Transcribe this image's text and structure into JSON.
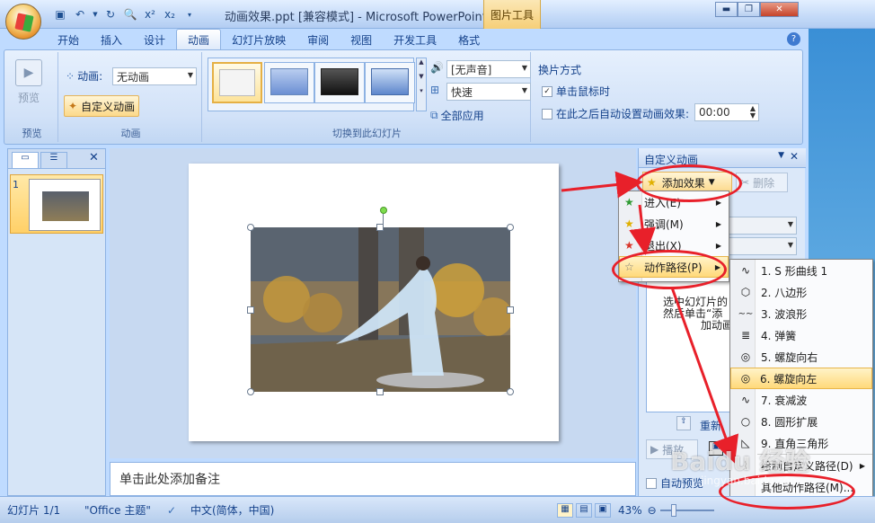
{
  "window": {
    "title": "动画效果.ppt [兼容模式] - Microsoft PowerPoint",
    "tool_context": "图片工具"
  },
  "tabs": [
    {
      "label": "开始",
      "active": false
    },
    {
      "label": "插入",
      "active": false
    },
    {
      "label": "设计",
      "active": false
    },
    {
      "label": "动画",
      "active": true
    },
    {
      "label": "幻灯片放映",
      "active": false
    },
    {
      "label": "审阅",
      "active": false
    },
    {
      "label": "视图",
      "active": false
    },
    {
      "label": "开发工具",
      "active": false
    },
    {
      "label": "格式",
      "active": false
    }
  ],
  "ribbon": {
    "preview_group": {
      "button": "预览",
      "label": "预览"
    },
    "animation_group": {
      "anim_label": "动画:",
      "anim_value": "无动画",
      "custom_anim": "自定义动画",
      "label": "动画"
    },
    "transition_group": {
      "sound_value": "[无声音]",
      "speed_value": "快速",
      "apply_all": "全部应用",
      "label": "切换到此幻灯片"
    },
    "advance_group": {
      "title": "换片方式",
      "on_click": "单击鼠标时",
      "on_click_checked": true,
      "auto_after": "在此之后自动设置动画效果:",
      "auto_after_checked": false,
      "auto_time": "00:00"
    }
  },
  "left_pane": {
    "slide_number": "1"
  },
  "notes": {
    "placeholder": "单击此处添加备注"
  },
  "custom_pane": {
    "title": "自定义动画",
    "add_effect": "添加效果",
    "remove": "删除",
    "hint_line1": "选中幻灯片的",
    "hint_line2": "然后单击“添",
    "hint_line3": "加动画",
    "reorder": "重新",
    "play": "播放",
    "auto_preview": "自动预览"
  },
  "menu_effect_types": [
    {
      "label": "进入(E)"
    },
    {
      "label": "强调(M)"
    },
    {
      "label": "退出(X)"
    },
    {
      "label": "动作路径(P)",
      "highlighted": true
    }
  ],
  "menu_paths": [
    {
      "label": "1. S 形曲线 1",
      "icon": "s-curve-icon"
    },
    {
      "label": "2. 八边形",
      "icon": "octagon-icon"
    },
    {
      "label": "3. 波浪形",
      "icon": "wave-icon"
    },
    {
      "label": "4. 弹簧",
      "icon": "spring-icon"
    },
    {
      "label": "5. 螺旋向右",
      "icon": "spiral-right-icon"
    },
    {
      "label": "6. 螺旋向左",
      "icon": "spiral-left-icon",
      "highlighted": true
    },
    {
      "label": "7. 衰减波",
      "icon": "decaying-wave-icon"
    },
    {
      "label": "8. 圆形扩展",
      "icon": "circle-expand-icon"
    },
    {
      "label": "9. 直角三角形",
      "icon": "right-triangle-icon"
    },
    {
      "label": "绘制自定义路径(D)",
      "icon": "draw-path-icon",
      "submenu": true
    },
    {
      "label": "其他动作路径(M)...",
      "icon": "",
      "submenu": false
    }
  ],
  "status": {
    "slide": "幻灯片 1/1",
    "theme": "\"Office 主题\"",
    "language": "中文(简体，中国)",
    "zoom": "43%"
  },
  "watermark": {
    "line1": "Baidu 经验",
    "line2": "jingyan.baidu.com"
  }
}
